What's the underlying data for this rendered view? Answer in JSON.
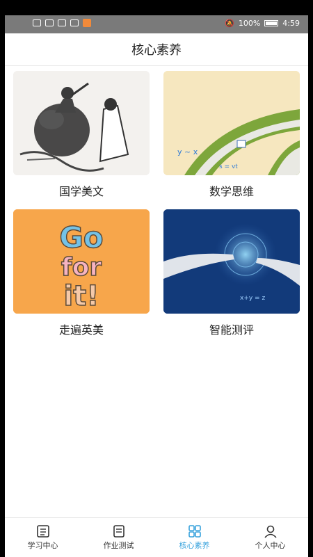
{
  "status_bar": {
    "battery": "100%",
    "time": "4:59"
  },
  "header": {
    "title": "核心素养"
  },
  "cards": [
    {
      "label": "国学美文",
      "image": "ink-painting-image"
    },
    {
      "label": "数学思维",
      "image": "math-road-image"
    },
    {
      "label": "走遍英美",
      "image": "go-for-it-image",
      "image_text": "Go for it!"
    },
    {
      "label": "智能测评",
      "image": "touching-hands-image"
    }
  ],
  "tabbar": {
    "items": [
      {
        "label": "学习中心",
        "icon": "book-icon",
        "active": false
      },
      {
        "label": "作业测试",
        "icon": "document-icon",
        "active": false
      },
      {
        "label": "核心素养",
        "icon": "grid-icon",
        "active": true
      },
      {
        "label": "个人中心",
        "icon": "person-icon",
        "active": false
      }
    ],
    "active_color": "#37a2dc"
  }
}
